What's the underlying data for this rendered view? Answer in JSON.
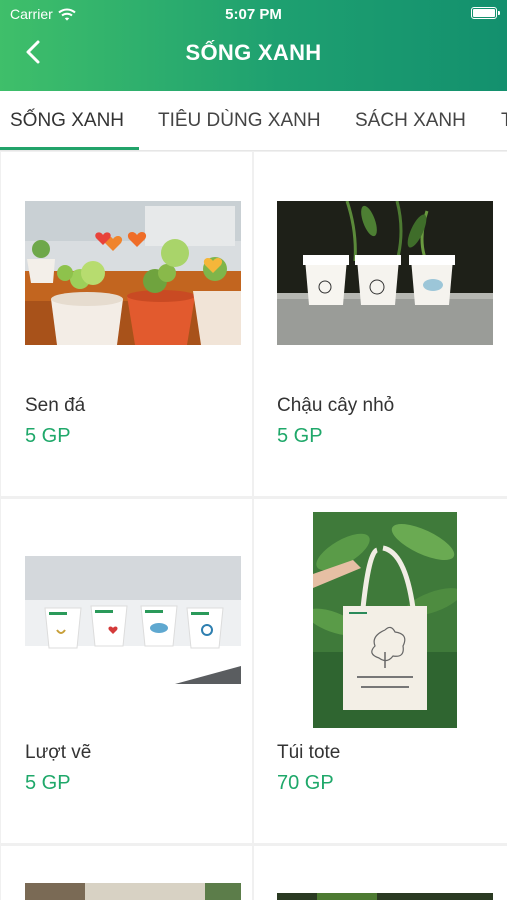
{
  "status_bar": {
    "carrier": "Carrier",
    "time": "5:07 PM"
  },
  "nav": {
    "title": "SỐNG XANH"
  },
  "tabs": [
    {
      "label": "SỐNG XANH",
      "active": true
    },
    {
      "label": "TIÊU DÙNG XANH",
      "active": false
    },
    {
      "label": "SÁCH XANH",
      "active": false
    },
    {
      "label": "T",
      "active": false
    }
  ],
  "colors": {
    "accent": "#22a36a",
    "price": "#1fa86a",
    "header_start": "#3fbf6a",
    "header_end": "#13906e"
  },
  "products": [
    {
      "name": "Sen đá",
      "price": "5 GP",
      "image": "succulent-pots-photo"
    },
    {
      "name": "Chậu cây nhỏ",
      "price": "5 GP",
      "image": "small-plant-pots-photo"
    },
    {
      "name": "Lượt vẽ",
      "price": "5 GP",
      "image": "painted-cups-photo"
    },
    {
      "name": "Túi tote",
      "price": "70 GP",
      "image": "tote-bag-photo"
    }
  ]
}
